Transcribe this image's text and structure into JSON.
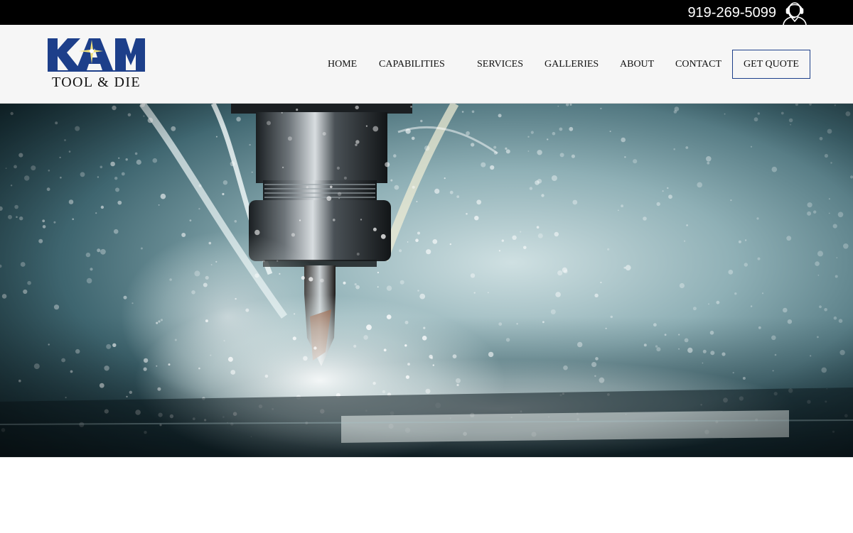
{
  "topbar": {
    "phone": "919-269-5099",
    "phone_icon": "headset-icon"
  },
  "header": {
    "logo": {
      "mark_text": "KAM",
      "sub_text": "TOOL & DIE",
      "mark_color": "#1d3f8a",
      "spark_color": "#f2e27a"
    },
    "nav": {
      "items": [
        {
          "label": "HOME"
        },
        {
          "label": "CAPABILITIES"
        },
        {
          "label": "SERVICES"
        },
        {
          "label": "GALLERIES"
        },
        {
          "label": "ABOUT"
        },
        {
          "label": "CONTACT"
        }
      ],
      "quote_label": "GET QUOTE"
    }
  },
  "hero": {
    "image": "cnc-milling-coolant-splash-photo"
  },
  "colors": {
    "topbar_bg": "#000000",
    "header_bg": "#f6f6f6",
    "accent": "#1d3f8a",
    "hero_tone": "#2c4c55"
  }
}
